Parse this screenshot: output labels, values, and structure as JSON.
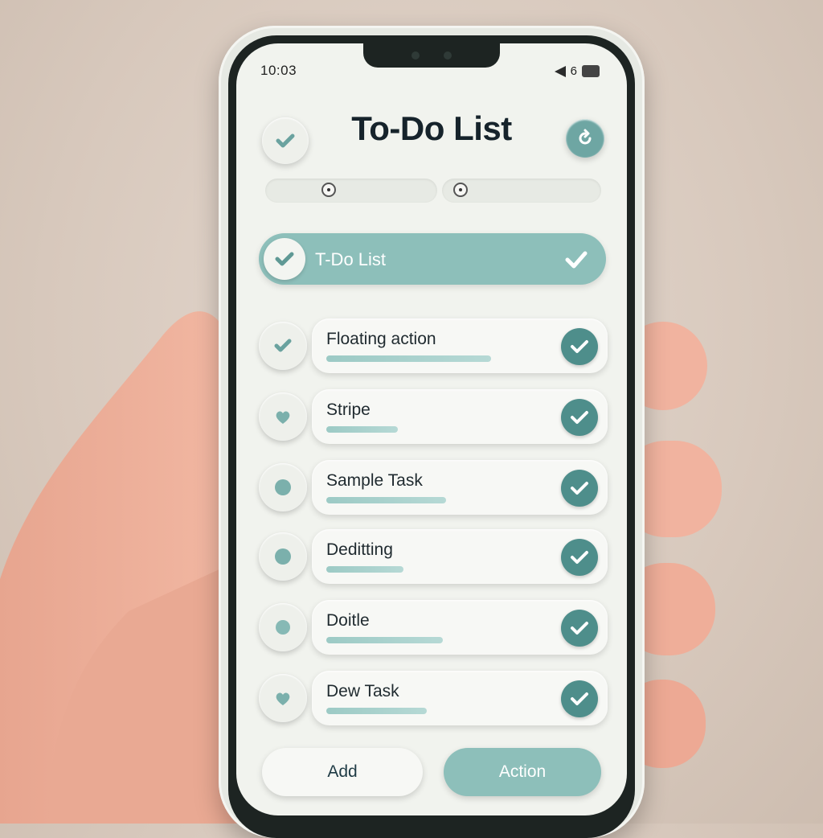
{
  "status": {
    "time": "10:03",
    "battery": "6"
  },
  "header": {
    "title": "To-Do List"
  },
  "list_header": {
    "label": "T-Do List"
  },
  "tasks": [
    {
      "label": "Floating action",
      "progress": 0.62
    },
    {
      "label": "Stripe",
      "progress": 0.27
    },
    {
      "label": "Sample Task",
      "progress": 0.45
    },
    {
      "label": "Deditting",
      "progress": 0.29
    },
    {
      "label": "Doitle",
      "progress": 0.44
    },
    {
      "label": "Dew Task",
      "progress": 0.38
    }
  ],
  "buttons": {
    "add": "Add",
    "action": "Action"
  },
  "colors": {
    "accent": "#8dbfba",
    "check": "#4e8e8b",
    "screen": "#f1f3ee"
  },
  "icons": [
    "check-icon",
    "refresh-icon",
    "radio-icon",
    "signal-icon",
    "battery-icon"
  ]
}
